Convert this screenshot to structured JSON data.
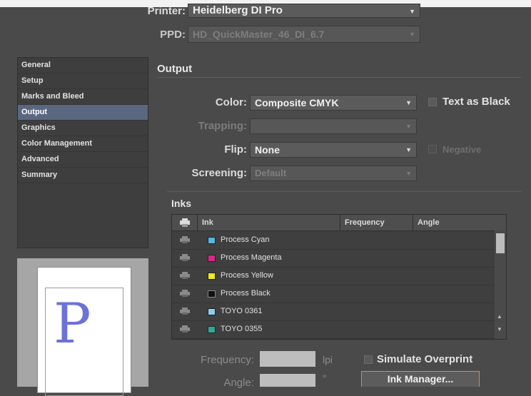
{
  "printer": {
    "label": "Printer:",
    "value": "Heidelberg DI Pro"
  },
  "ppd": {
    "label": "PPD:",
    "value": "HD_QuickMaster_46_DI_6.7"
  },
  "sidebar": {
    "items": [
      {
        "label": "General"
      },
      {
        "label": "Setup"
      },
      {
        "label": "Marks and Bleed"
      },
      {
        "label": "Output"
      },
      {
        "label": "Graphics"
      },
      {
        "label": "Color Management"
      },
      {
        "label": "Advanced"
      },
      {
        "label": "Summary"
      }
    ],
    "active_index": 3
  },
  "preview": {
    "glyph": "P"
  },
  "output": {
    "title": "Output",
    "color": {
      "label": "Color:",
      "value": "Composite CMYK"
    },
    "text_as_black": {
      "label": "Text as Black",
      "checked": false
    },
    "trapping": {
      "label": "Trapping:",
      "value": ""
    },
    "flip": {
      "label": "Flip:",
      "value": "None"
    },
    "negative": {
      "label": "Negative",
      "checked": false
    },
    "screening": {
      "label": "Screening:",
      "value": "Default"
    }
  },
  "inks": {
    "title": "Inks",
    "columns": [
      "Ink",
      "Frequency",
      "Angle"
    ],
    "rows": [
      {
        "name": "Process Cyan",
        "color": "#58b4e0"
      },
      {
        "name": "Process Magenta",
        "color": "#d8288a"
      },
      {
        "name": "Process Yellow",
        "color": "#f2ea1c"
      },
      {
        "name": "Process Black",
        "color": "#111111"
      },
      {
        "name": "TOYO 0361",
        "color": "#8fcdf0"
      },
      {
        "name": "TOYO 0355",
        "color": "#2fa89a"
      }
    ]
  },
  "bottom": {
    "frequency_label": "Frequency:",
    "frequency_unit": "lpi",
    "angle_label": "Angle:",
    "angle_unit": "°",
    "simulate_overprint": {
      "label": "Simulate Overprint",
      "checked": false
    },
    "ink_manager_label": "Ink Manager..."
  },
  "colors": {
    "accent": "#5a6780",
    "button_border": "#d4913a"
  }
}
